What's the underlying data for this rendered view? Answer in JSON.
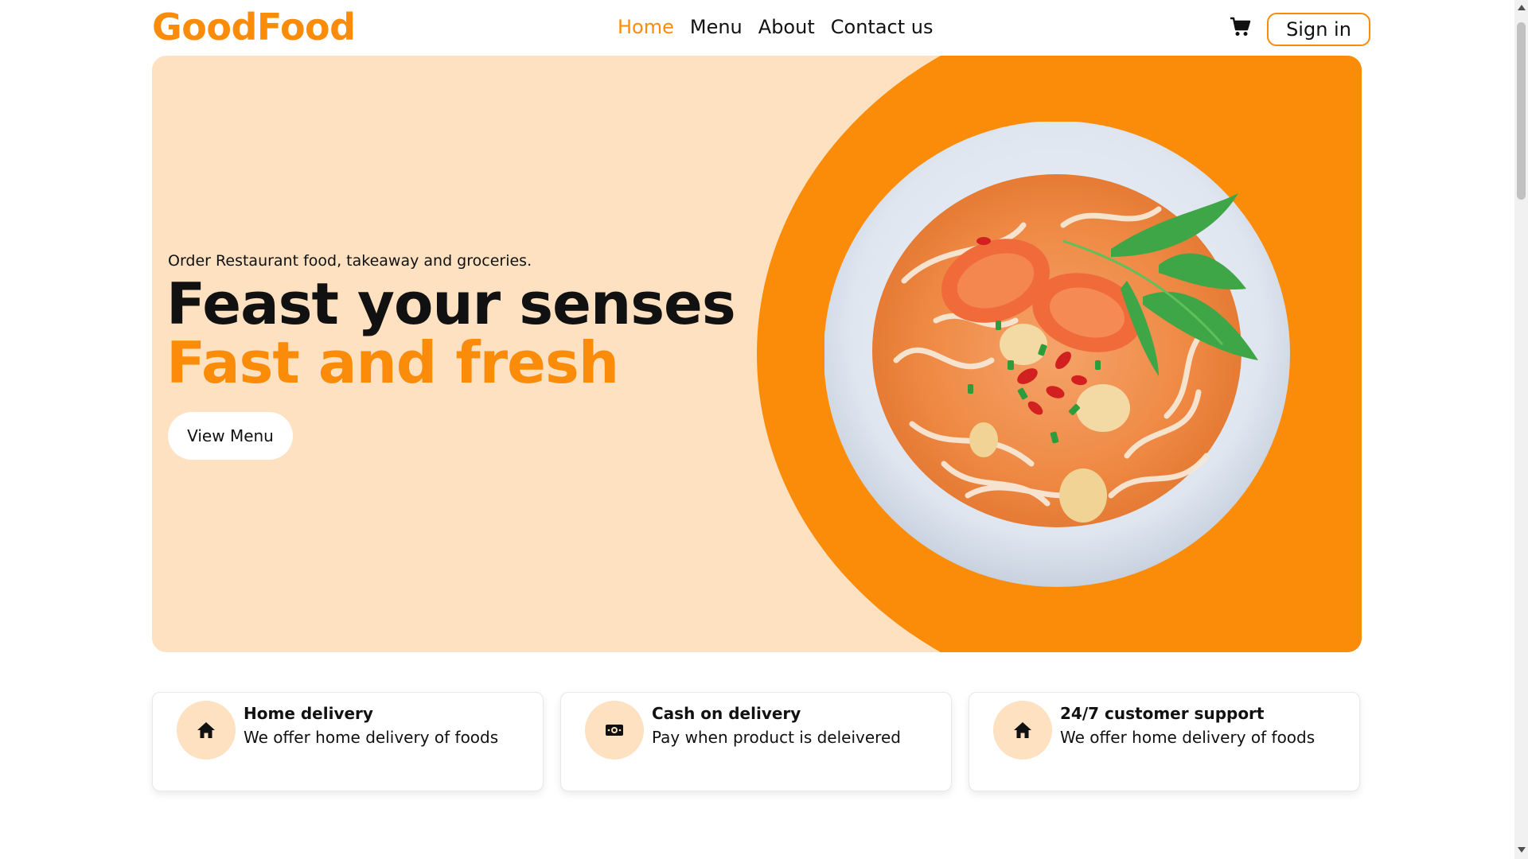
{
  "brand": {
    "name": "GoodFood",
    "accent_color": "#fb8c0a",
    "hero_bg_color": "#fde1c1"
  },
  "nav": {
    "links": [
      {
        "label": "Home",
        "active": true
      },
      {
        "label": "Menu",
        "active": false
      },
      {
        "label": "About",
        "active": false
      },
      {
        "label": "Contact us",
        "active": false
      }
    ],
    "cart_icon": "cart-icon",
    "signin_label": "Sign in"
  },
  "hero": {
    "subtitle": "Order Restaurant food, takeaway and groceries.",
    "title_line1": "Feast your senses",
    "title_line2": "Fast and fresh",
    "cta_label": "View Menu",
    "image": "noodle-soup-bowl"
  },
  "features": [
    {
      "icon": "home-icon",
      "title": "Home delivery",
      "description": "We offer home delivery of foods"
    },
    {
      "icon": "cash-icon",
      "title": "Cash on delivery",
      "description": "Pay when product is deleivered"
    },
    {
      "icon": "home-icon",
      "title": "24/7 customer support",
      "description": "We offer home delivery of foods"
    }
  ]
}
